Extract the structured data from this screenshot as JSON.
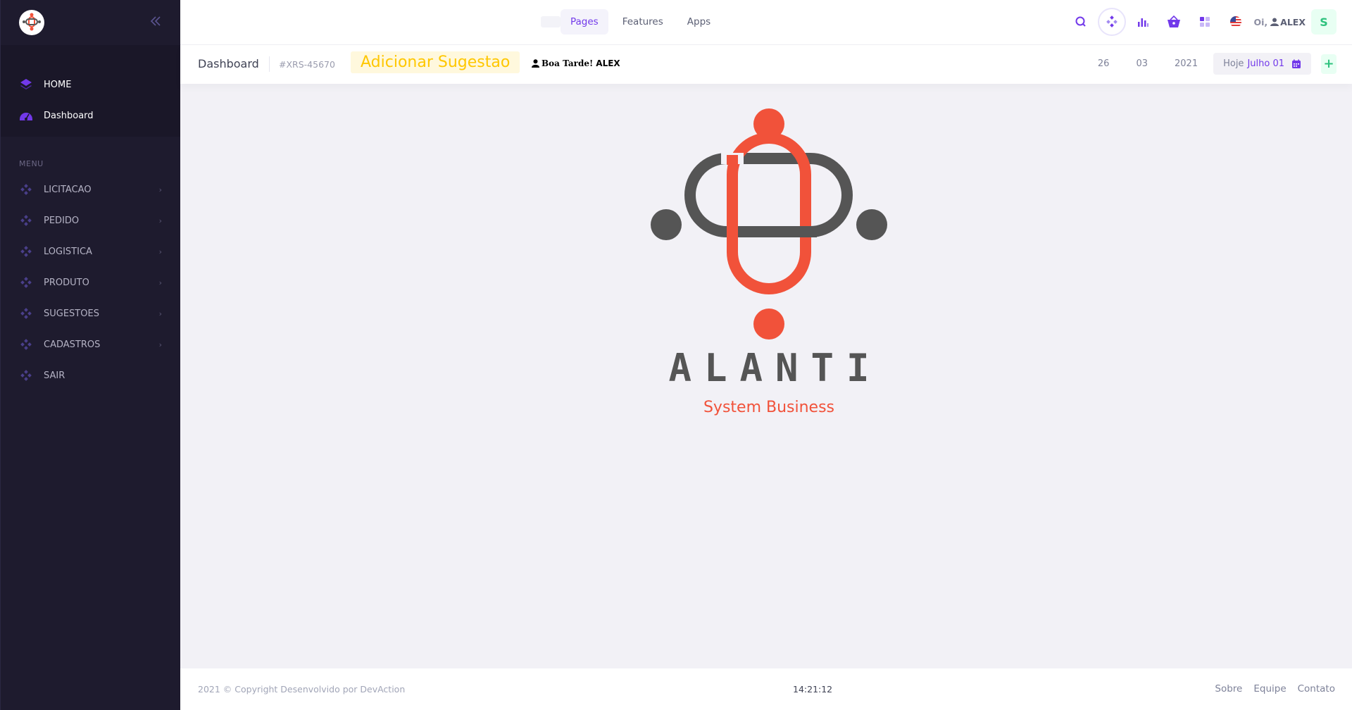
{
  "sidebar": {
    "top_items": [
      {
        "label": "HOME",
        "icon": "layers-icon"
      },
      {
        "label": "Dashboard",
        "icon": "gauge-icon"
      }
    ],
    "section_label": "MENU",
    "menu_items": [
      {
        "label": "LICITACAO"
      },
      {
        "label": "PEDIDO"
      },
      {
        "label": "LOGISTICA"
      },
      {
        "label": "PRODUTO"
      },
      {
        "label": "SUGESTOES"
      },
      {
        "label": "CADASTROS"
      },
      {
        "label": "SAIR"
      }
    ]
  },
  "header": {
    "nav": [
      "Pages",
      "Features",
      "Apps"
    ],
    "greeting_prefix": "Oi,",
    "user_name": "ALEX",
    "avatar_letter": "S"
  },
  "toolbar": {
    "title": "Dashboard",
    "code": "#XRS-45670",
    "suggest_button": "Adicionar Sugestao",
    "greeting": "Boa Tarde!",
    "greeting_user": "ALEX",
    "day": "26",
    "month": "03",
    "year": "2021",
    "today_label": "Hoje",
    "today_date": "Julho 01",
    "add_label": "+"
  },
  "content": {
    "brand_name": "ALANTI",
    "brand_sub": "System Business"
  },
  "footer": {
    "copyright": "2021 © Copyright Desenvolvido por DevAction",
    "clock": "14:21:12",
    "links": [
      "Sobre",
      "Equipe",
      "Contato"
    ]
  },
  "colors": {
    "accent": "#7239ea",
    "logo_red": "#f1523a",
    "logo_gray": "#555555",
    "suggest_yellow": "#ffc700",
    "sidebar_bg": "#1e1b2e"
  }
}
